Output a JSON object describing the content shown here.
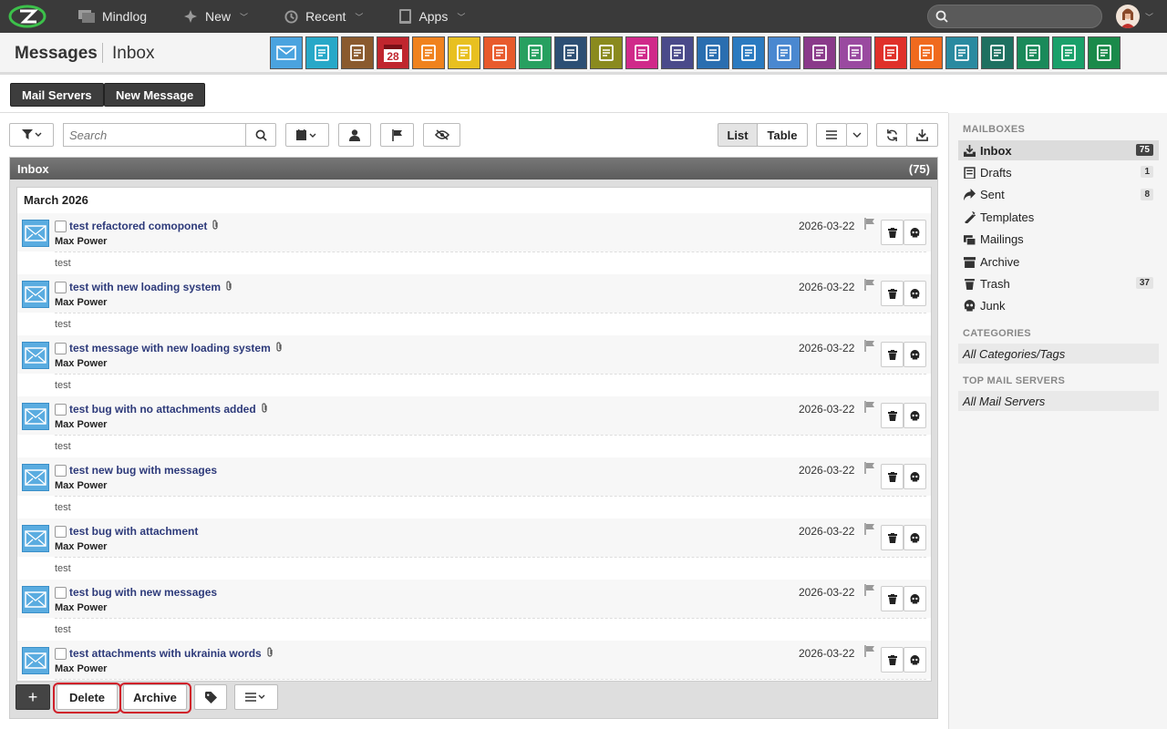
{
  "topnav": {
    "brand": "Mindlog",
    "new": "New",
    "recent": "Recent",
    "apps": "Apps"
  },
  "header": {
    "title": "Messages",
    "subtitle": "Inbox"
  },
  "app_icons": [
    {
      "name": "mail-app-icon",
      "color": "#4aa3df"
    },
    {
      "name": "address-book-app-icon",
      "color": "#27a8c8"
    },
    {
      "name": "contacts-app-icon",
      "color": "#8a5a2e"
    },
    {
      "name": "calendar-app-icon",
      "color": "#c0262e",
      "text": "28"
    },
    {
      "name": "timer-app-icon",
      "color": "#f0821e"
    },
    {
      "name": "tasks-app-icon",
      "color": "#e8c020"
    },
    {
      "name": "folder-check-app-icon",
      "color": "#e85a2c"
    },
    {
      "name": "notes-app-icon",
      "color": "#27a060"
    },
    {
      "name": "bookmark-app-icon",
      "color": "#2d4f74"
    },
    {
      "name": "document-app-icon",
      "color": "#8a8a1e"
    },
    {
      "name": "reception-app-icon",
      "color": "#d02a8a"
    },
    {
      "name": "dollar-app-icon",
      "color": "#4a4a8a"
    },
    {
      "name": "shipping-app-icon",
      "color": "#2a6eb0"
    },
    {
      "name": "support-app-icon",
      "color": "#2a7ac0"
    },
    {
      "name": "invoice-app-icon",
      "color": "#4a88d0"
    },
    {
      "name": "contract-app-icon",
      "color": "#8a3a8a"
    },
    {
      "name": "deal-app-icon",
      "color": "#9a4aa0"
    },
    {
      "name": "pdf-app-icon",
      "color": "#e0302a"
    },
    {
      "name": "broadcast-app-icon",
      "color": "#f06a1e"
    },
    {
      "name": "download-app-icon",
      "color": "#2a8aa0"
    },
    {
      "name": "cart-app-icon",
      "color": "#1e7060"
    },
    {
      "name": "cash-app-icon",
      "color": "#1a8a5a"
    },
    {
      "name": "price-tag-app-icon",
      "color": "#1aa06a"
    },
    {
      "name": "database-app-icon",
      "color": "#1a8a4a"
    }
  ],
  "actions": {
    "mail_servers": "Mail Servers",
    "new_message": "New Message"
  },
  "toolbar": {
    "search_placeholder": "Search",
    "list": "List",
    "table": "Table"
  },
  "panel": {
    "title": "Inbox",
    "count": "(75)",
    "month": "March 2026"
  },
  "messages": [
    {
      "subject": "test refactored comoponet",
      "from": "Max Power",
      "date": "2026-03-22",
      "preview": "test",
      "attachment": true
    },
    {
      "subject": "test with new loading system",
      "from": "Max Power",
      "date": "2026-03-22",
      "preview": "test",
      "attachment": true
    },
    {
      "subject": "test message with new loading system",
      "from": "Max Power",
      "date": "2026-03-22",
      "preview": "test",
      "attachment": true
    },
    {
      "subject": "test bug with no attachments added",
      "from": "Max Power",
      "date": "2026-03-22",
      "preview": "test",
      "attachment": true
    },
    {
      "subject": "test new bug with messages",
      "from": "Max Power",
      "date": "2026-03-22",
      "preview": "test",
      "attachment": false
    },
    {
      "subject": "test bug with attachment",
      "from": "Max Power",
      "date": "2026-03-22",
      "preview": "test",
      "attachment": false
    },
    {
      "subject": "test bug with new messages",
      "from": "Max Power",
      "date": "2026-03-22",
      "preview": "test",
      "attachment": false
    },
    {
      "subject": "test attachments with ukrainia words",
      "from": "Max Power",
      "date": "2026-03-22",
      "preview": "",
      "attachment": true
    }
  ],
  "footer": {
    "add": "+",
    "delete": "Delete",
    "archive": "Archive"
  },
  "sidebar": {
    "mailboxes_heading": "MAILBOXES",
    "mailboxes": [
      {
        "label": "Inbox",
        "count": "75",
        "active": true,
        "icon": "inbox-icon"
      },
      {
        "label": "Drafts",
        "count": "1",
        "icon": "drafts-icon"
      },
      {
        "label": "Sent",
        "count": "8",
        "icon": "sent-icon"
      },
      {
        "label": "Templates",
        "count": "",
        "icon": "templates-icon"
      },
      {
        "label": "Mailings",
        "count": "",
        "icon": "mailings-icon"
      },
      {
        "label": "Archive",
        "count": "",
        "icon": "archive-icon"
      },
      {
        "label": "Trash",
        "count": "37",
        "icon": "trash-icon"
      },
      {
        "label": "Junk",
        "count": "",
        "icon": "junk-icon"
      }
    ],
    "categories_heading": "CATEGORIES",
    "categories_all": "All Categories/Tags",
    "servers_heading": "TOP MAIL SERVERS",
    "servers_all": "All Mail Servers"
  }
}
